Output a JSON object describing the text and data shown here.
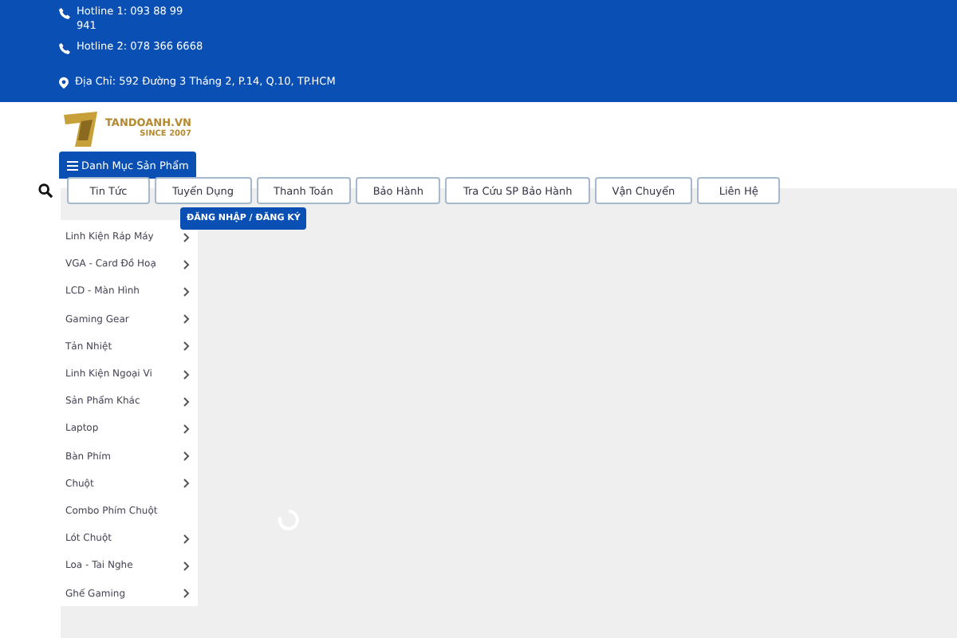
{
  "top_bar": {
    "hotlines": [
      "Hotline 1: 093 88 99 941",
      "Hotline 2: 078 366 6668"
    ],
    "address": "Địa Chỉ: 592 Đường 3 Tháng 2, P.14, Q.10, TP.HCM"
  },
  "logo": {
    "name": "TANDOANH.VN",
    "tagline": "SINCE 2007"
  },
  "category_button": "Danh Mục Sản Phẩm",
  "nav": [
    "Tin Tức",
    "Tuyển Dụng",
    "Thanh Toán",
    "Bảo Hành",
    "Tra Cứu SP Bảo Hành",
    "Vận Chuyển",
    "Liên Hệ"
  ],
  "login_button": "ĐĂNG NHẬP / ĐĂNG KÝ",
  "categories": [
    {
      "label": "Linh Kiện Ráp Máy",
      "has_submenu": true
    },
    {
      "label": "VGA - Card Đồ Hoạ",
      "has_submenu": true
    },
    {
      "label": "LCD - Màn Hình",
      "has_submenu": true
    },
    {
      "label": "Gaming Gear",
      "has_submenu": true
    },
    {
      "label": "Tản Nhiệt",
      "has_submenu": true
    },
    {
      "label": "Linh Kiện Ngoại Vi",
      "has_submenu": true
    },
    {
      "label": "Sản Phẩm Khác",
      "has_submenu": true
    },
    {
      "label": "Laptop",
      "has_submenu": true
    },
    {
      "label": "Bàn Phím",
      "has_submenu": true
    },
    {
      "label": "Chuột",
      "has_submenu": true
    },
    {
      "label": "Combo Phím Chuột",
      "has_submenu": false
    },
    {
      "label": "Lót Chuột",
      "has_submenu": true
    },
    {
      "label": "Loa - Tai Nghe",
      "has_submenu": true
    },
    {
      "label": "Ghế Gaming",
      "has_submenu": true
    }
  ]
}
